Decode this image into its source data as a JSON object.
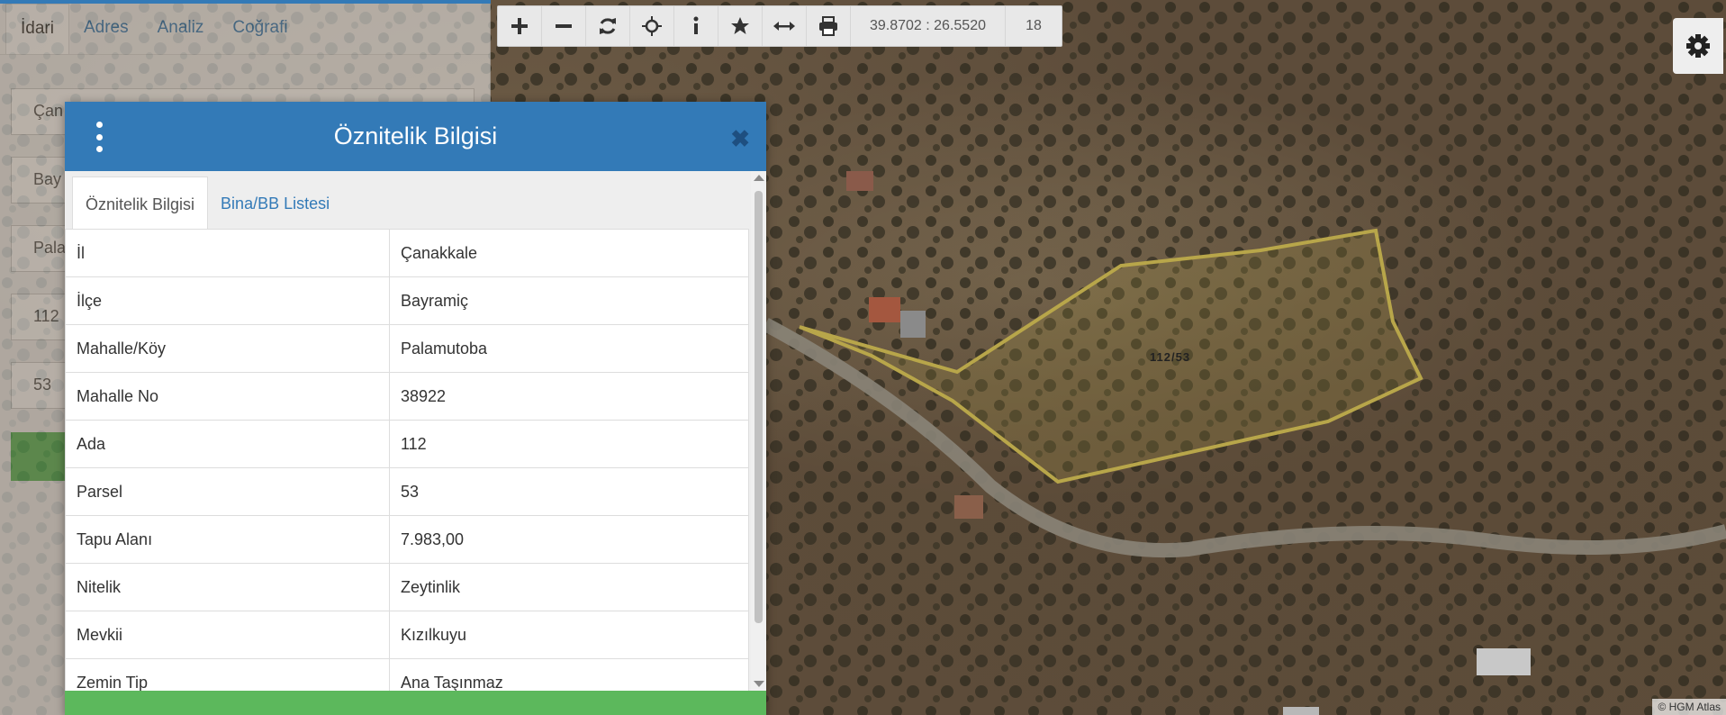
{
  "colors": {
    "primary": "#337ab7",
    "success": "#5cb85c",
    "parcel_outline": "#b8a64a"
  },
  "sidebar": {
    "tabs": [
      "İdari",
      "Adres",
      "Analiz",
      "Coğrafi"
    ],
    "fields": [
      "Çan",
      "Bay",
      "Pala",
      "112",
      "53"
    ]
  },
  "toolbar": {
    "icons": [
      "plus-icon",
      "minus-icon",
      "refresh-icon",
      "crosshair-icon",
      "info-icon",
      "star-icon",
      "measure-icon",
      "print-icon"
    ],
    "coordinates": "39.8702 : 26.5520",
    "zoom": "18"
  },
  "map": {
    "parcel_label": "112/53",
    "attribution": "© HGM Atlas"
  },
  "dialog": {
    "title": "Öznitelik Bilgisi",
    "tabs": [
      "Öznitelik Bilgisi",
      "Bina/BB Listesi"
    ],
    "rows": [
      {
        "key": "İl",
        "value": "Çanakkale"
      },
      {
        "key": "İlçe",
        "value": "Bayramiç"
      },
      {
        "key": "Mahalle/Köy",
        "value": "Palamutoba"
      },
      {
        "key": "Mahalle No",
        "value": "38922"
      },
      {
        "key": "Ada",
        "value": "112"
      },
      {
        "key": "Parsel",
        "value": "53"
      },
      {
        "key": "Tapu Alanı",
        "value": "7.983,00"
      },
      {
        "key": "Nitelik",
        "value": "Zeytinlik"
      },
      {
        "key": "Mevkii",
        "value": "Kızılkuyu"
      },
      {
        "key": "Zemin Tip",
        "value": "Ana Taşınmaz"
      }
    ]
  }
}
